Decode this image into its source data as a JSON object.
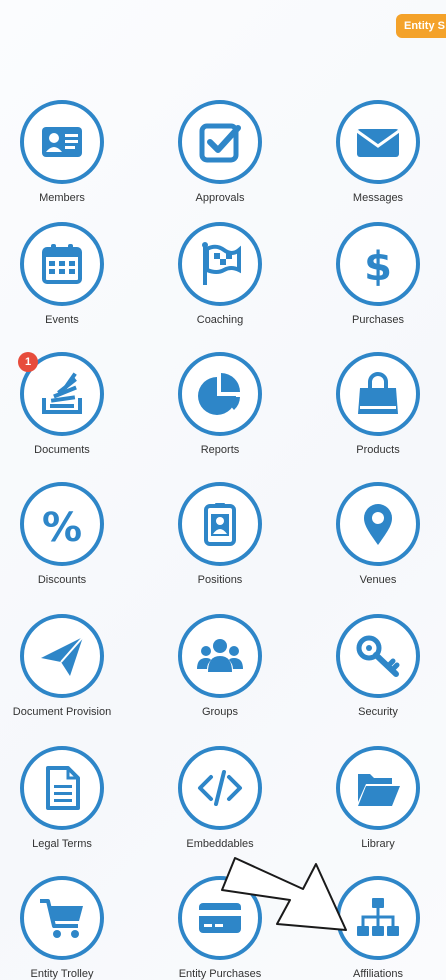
{
  "header": {
    "entity_button_label": "Entity S"
  },
  "tiles": [
    {
      "label": "Members",
      "icon": "id-card-icon"
    },
    {
      "label": "Approvals",
      "icon": "check-square-icon"
    },
    {
      "label": "Messages",
      "icon": "envelope-icon"
    },
    {
      "label": "Events",
      "icon": "calendar-icon"
    },
    {
      "label": "Coaching",
      "icon": "flag-icon"
    },
    {
      "label": "Purchases",
      "icon": "dollar-icon"
    },
    {
      "label": "Documents",
      "icon": "stack-icon",
      "badge": "1"
    },
    {
      "label": "Reports",
      "icon": "pie-chart-icon"
    },
    {
      "label": "Products",
      "icon": "shopping-bag-icon"
    },
    {
      "label": "Discounts",
      "icon": "percent-icon"
    },
    {
      "label": "Positions",
      "icon": "badge-id-icon"
    },
    {
      "label": "Venues",
      "icon": "map-marker-icon"
    },
    {
      "label": "Document Provision",
      "icon": "paper-plane-icon"
    },
    {
      "label": "Groups",
      "icon": "users-icon"
    },
    {
      "label": "Security",
      "icon": "key-icon"
    },
    {
      "label": "Legal Terms",
      "icon": "document-icon"
    },
    {
      "label": "Embeddables",
      "icon": "code-icon"
    },
    {
      "label": "Library",
      "icon": "folder-open-icon"
    },
    {
      "label": "Entity Trolley",
      "icon": "shopping-cart-icon"
    },
    {
      "label": "Entity Purchases",
      "icon": "credit-card-icon"
    },
    {
      "label": "Affiliations",
      "icon": "sitemap-icon"
    }
  ],
  "colors": {
    "accent": "#2e86c8",
    "pill": "#f4a22a",
    "badge": "#e74c3c"
  }
}
